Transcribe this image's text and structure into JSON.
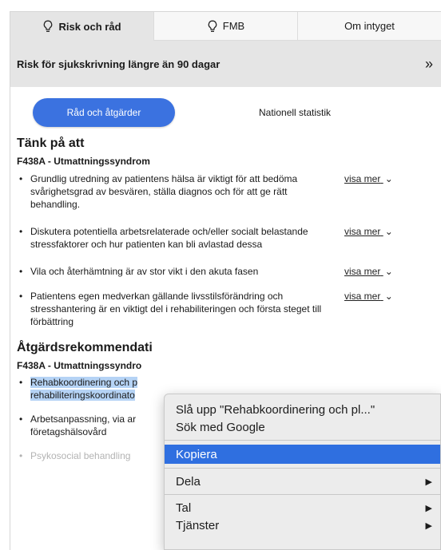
{
  "tabs": [
    {
      "label": "Risk och råd",
      "icon": "lightbulb-icon",
      "active": true
    },
    {
      "label": "FMB",
      "icon": "lightbulb-icon",
      "active": false
    },
    {
      "label": "Om intyget",
      "active": false
    }
  ],
  "banner": {
    "title": "Risk för sjukskrivning längre än 90 dagar",
    "toggle": "»"
  },
  "subtabs": {
    "active": "Råd och åtgärder",
    "other": "Nationell statistik"
  },
  "section1": {
    "title": "Tänk på att",
    "code": "F438A - Utmattningssyndrom",
    "items": [
      {
        "text": "Grundlig utredning av patientens hälsa är viktigt för att bedöma svårighetsgrad av besvären, ställa diagnos och för att ge rätt behandling.",
        "more": "visa mer"
      },
      {
        "text": "Diskutera potentiella arbetsrelaterade och/eller socialt belastande stressfaktorer och hur patienten kan bli avlastad dessa",
        "more": "visa mer"
      },
      {
        "text": "Vila och återhämtning är av stor vikt i den akuta fasen",
        "more": "visa mer"
      },
      {
        "text": "Patientens egen medverkan gällande livsstilsförändring och stresshantering är en viktigt del i rehabiliteringen och första steget till förbättring",
        "more": "visa mer"
      }
    ]
  },
  "section2": {
    "title": "Åtgärdsrekommendati",
    "code": "F438A - Utmattningssyndro",
    "items": [
      {
        "text": "Rehabkoordinering och p rehabiliteringskoordinato"
      },
      {
        "text": "Arbetsanpassning, via ar företagshälsovård"
      },
      {
        "text": "Psykosocial behandling"
      }
    ]
  },
  "context_menu": {
    "lookup": "Slå upp \"Rehabkoordinering och pl...\"",
    "search": "Sök med Google",
    "copy": "Kopiera",
    "share": "Dela",
    "speech": "Tal",
    "services": "Tjänster",
    "submenu_arrow": "▶"
  },
  "colors": {
    "accent": "#3b72e0",
    "selection": "#b5d3f5",
    "menu_highlight": "#2f6fe0",
    "banner_bg": "#e5e5e5"
  }
}
